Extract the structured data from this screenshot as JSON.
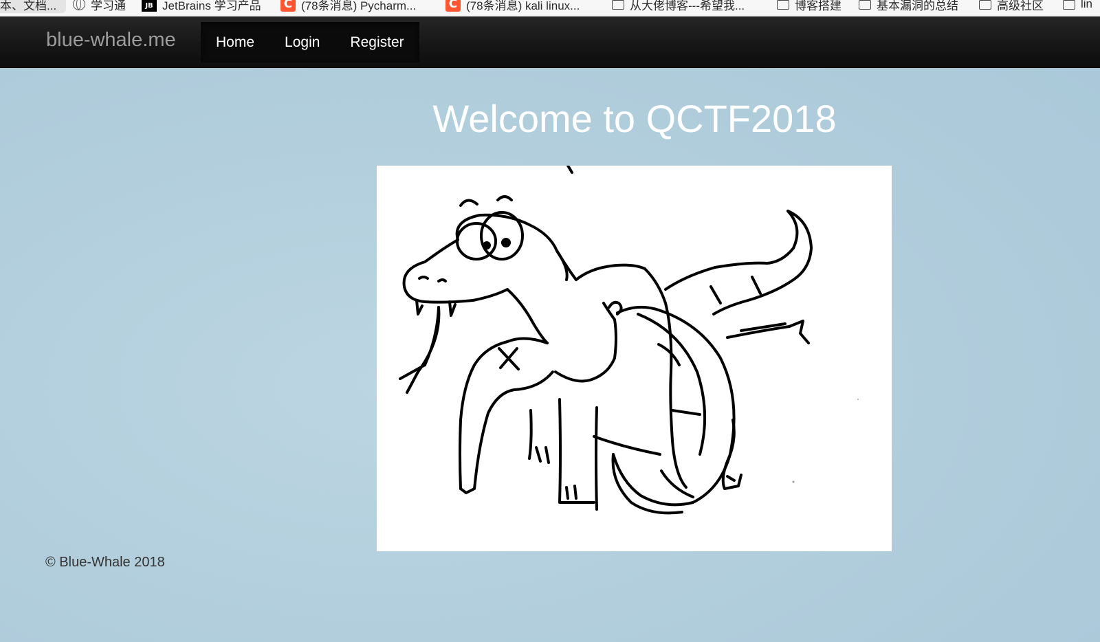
{
  "bookmarks": [
    {
      "label": "本、文档...",
      "icon": "none"
    },
    {
      "label": "学习通",
      "icon": "globe-icon"
    },
    {
      "label": "JetBrains 学习产品",
      "icon": "jetbrains-icon"
    },
    {
      "label": "(78条消息) Pycharm...",
      "icon": "csdn-icon"
    },
    {
      "label": "(78条消息) kali linux...",
      "icon": "csdn-icon"
    },
    {
      "label": "从大佬博客---希望我...",
      "icon": "folder-icon"
    },
    {
      "label": "博客搭建",
      "icon": "folder-icon"
    },
    {
      "label": "基本漏洞的总结",
      "icon": "folder-icon"
    },
    {
      "label": "高级社区",
      "icon": "folder-icon"
    },
    {
      "label": "lin",
      "icon": "folder-icon"
    }
  ],
  "navbar": {
    "brand": "blue-whale.me",
    "links": [
      "Home",
      "Login",
      "Register"
    ]
  },
  "main": {
    "heading": "Welcome to QCTF2018",
    "image_description": "python-snake-eating-php-elephant-sketch"
  },
  "footer": {
    "copyright": "© Blue-Whale 2018"
  },
  "colors": {
    "navbar_bg": "#151515",
    "brand_text": "#9d9d9d",
    "page_bg": "#b3cfdd",
    "heading": "#ffffff",
    "footer_text": "#333333"
  }
}
